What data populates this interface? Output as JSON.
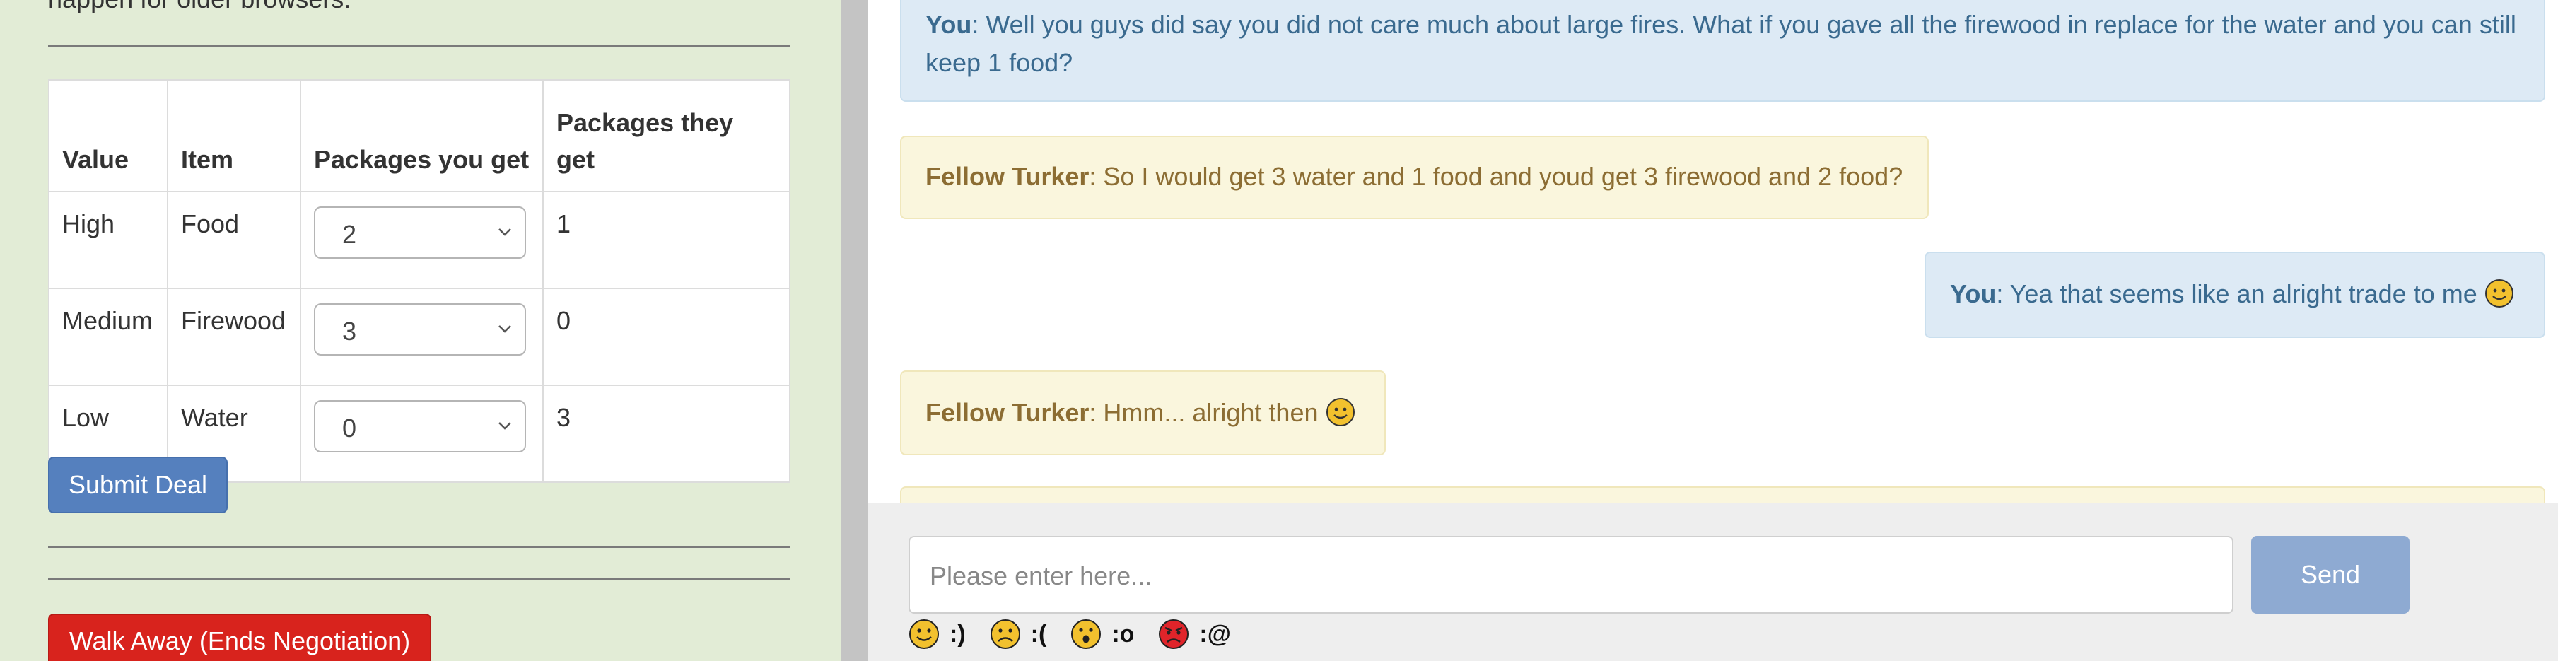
{
  "left": {
    "cut_text": "happen for older browsers.",
    "table": {
      "headers": [
        "Value",
        "Item",
        "Packages you get",
        "Packages they get"
      ],
      "rows": [
        {
          "value": "High",
          "item": "Food",
          "you": "2",
          "they": "1"
        },
        {
          "value": "Medium",
          "item": "Firewood",
          "you": "3",
          "they": "0"
        },
        {
          "value": "Low",
          "item": "Water",
          "you": "0",
          "they": "3"
        }
      ]
    },
    "submit_label": "Submit Deal",
    "walk_label": "Walk Away (Ends Negotiation)"
  },
  "chat": {
    "messages": [
      {
        "speaker": "You",
        "text": ": Well you guys did say you did not care much about large fires. What if you gave all the firewood in replace for the water and you can still keep 1 food?"
      },
      {
        "speaker": "Fellow Turker",
        "text": ": So I would get 3 water and 1 food and youd get 3 firewood and 2 food?"
      },
      {
        "speaker": "You",
        "text": ": Yea that seems like an alright trade to me"
      },
      {
        "speaker": "Fellow Turker",
        "text": ": Hmm... alright then"
      }
    ],
    "input_placeholder": "Please enter here...",
    "send_label": "Send",
    "emoticons": [
      {
        "icon": "smile-icon",
        "code": ":)",
        "color": "#f2c12e"
      },
      {
        "icon": "sad-icon",
        "code": ":(",
        "color": "#f2c12e"
      },
      {
        "icon": "surprised-icon",
        "code": ":o",
        "color": "#f2c12e"
      },
      {
        "icon": "angry-icon",
        "code": ":@",
        "color": "#e0242a"
      }
    ]
  }
}
